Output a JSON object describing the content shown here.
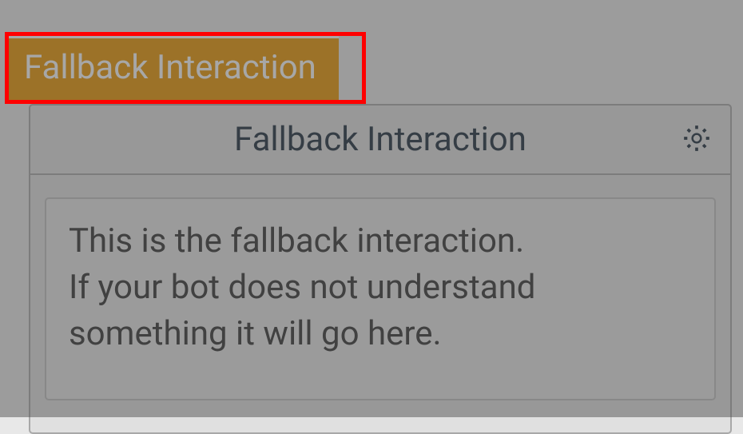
{
  "tab": {
    "label": "Fallback Interaction"
  },
  "panel": {
    "title": "Fallback Interaction",
    "description": "This is the fallback interaction.\nIf your bot does not understand something it will go here."
  }
}
